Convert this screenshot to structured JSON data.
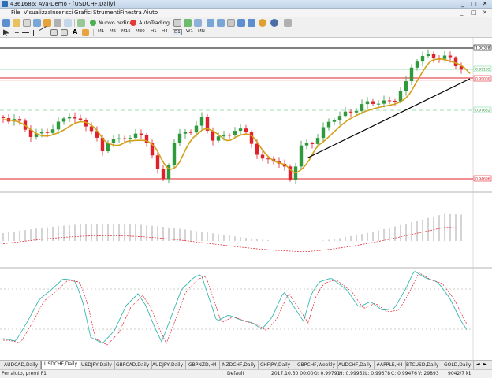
{
  "window": {
    "title": "4361686: Ava-Demo - [USDCHF,Daily]",
    "controls": [
      "_",
      "□",
      "✕"
    ]
  },
  "menu": {
    "items": [
      "File",
      "Visualizza",
      "Inserisci",
      "Grafici",
      "Strumenti",
      "Finestra",
      "Aiuto"
    ],
    "mdi_controls": [
      "_",
      "□",
      "✕"
    ]
  },
  "toolbar": {
    "new_order_label": "Nuovo ordine",
    "autotrading_label": "AutoTrading",
    "timeframes": [
      "M1",
      "M5",
      "M15",
      "M30",
      "H1",
      "H4",
      "D1",
      "W1",
      "MN"
    ]
  },
  "price_tags": {
    "top_black": "1.00328",
    "green_top": "0.99185",
    "red_bid": "0.99000",
    "dashed_green": "0.97632",
    "bottom_red": "0.94696"
  },
  "tabs": [
    "AUDCAD,Daily",
    "USDCHF,Daily",
    "USDJPY,Daily",
    "GBPCAD,Daily",
    "AUDJPY,Daily",
    "GBPNZD,H4",
    "NZDCHF,Daily",
    "CHFJPY,Daily",
    "GBPCHF,Weekly",
    "AUDCHF,Daily",
    "#APPLE,H4",
    "BTCUSD,Daily",
    "GOLD,Daily"
  ],
  "active_tab": "USDCHF,Daily",
  "status": {
    "help": "Per aiuto, premi F1",
    "profile": "Default",
    "datetime": "2017.10.30 00:00",
    "open": "O: 0.99791",
    "high": "H: 0.99952",
    "low": "L: 0.99378",
    "close": "C: 0.99476",
    "volume": "V: 29893",
    "traffic": "9042/7 kb"
  },
  "colors": {
    "bull": "#2e9a3c",
    "bear": "#e0202a",
    "ma": "#d4a017",
    "trendline": "#000000",
    "signal": "#e0202a",
    "stoch_main": "#36b8b0"
  }
}
